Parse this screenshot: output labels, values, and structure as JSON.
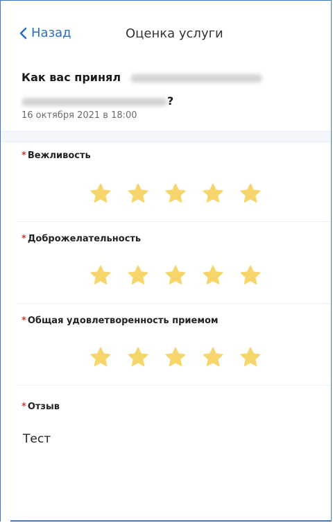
{
  "nav": {
    "back_label": "Назад",
    "title": "Оценка услуги"
  },
  "question": {
    "prefix": "Как вас принял",
    "suffix": "?",
    "date": "16 октября 2021 в 18:00"
  },
  "criteria": [
    {
      "label": "Вежливость",
      "rating": 5,
      "max": 5
    },
    {
      "label": "Доброжелательность",
      "rating": 5,
      "max": 5
    },
    {
      "label": "Общая удовлетворенность приемом",
      "rating": 5,
      "max": 5
    }
  ],
  "review": {
    "label": "Отзыв",
    "value": "Тест"
  },
  "required_marker": "*",
  "colors": {
    "accent": "#2b6fc4",
    "star": "#f6d56b",
    "required": "#d13a3a"
  }
}
